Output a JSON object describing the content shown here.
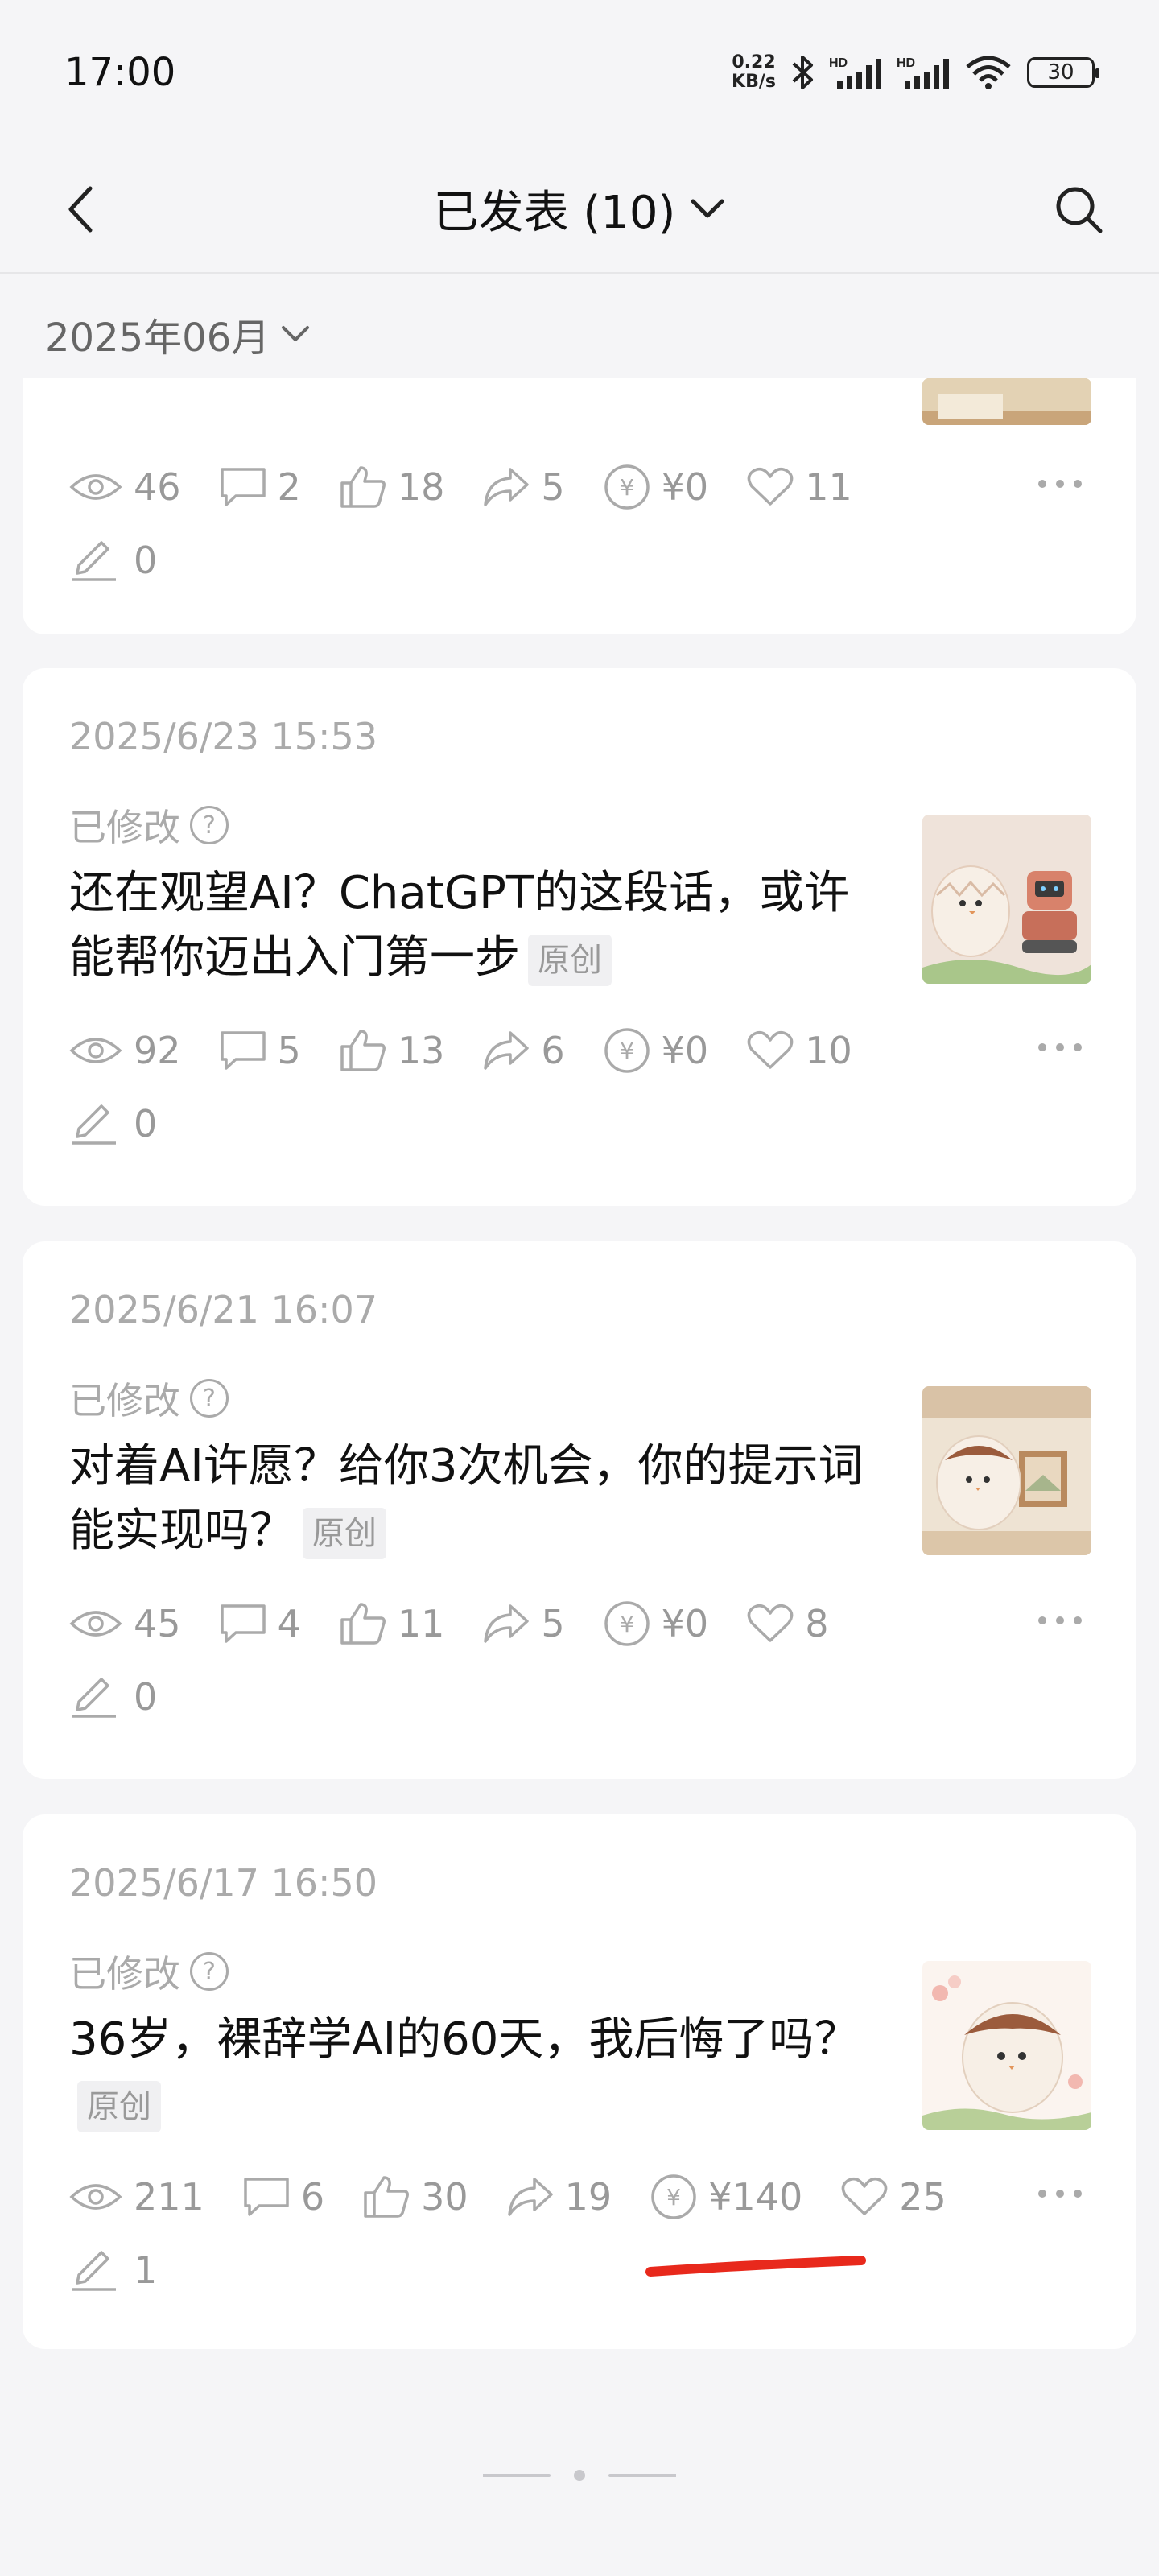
{
  "status_bar": {
    "time": "17:00",
    "net_speed_value": "0.22",
    "net_speed_unit": "KB/s",
    "battery": "30",
    "icons": [
      "bluetooth-icon",
      "hd-signal-icon",
      "hd-signal-icon",
      "wifi-icon",
      "battery-icon"
    ]
  },
  "nav": {
    "title": "已发表 (10)",
    "back_icon": "chevron-left-icon",
    "search_icon": "search-icon"
  },
  "filter": {
    "month": "2025年06月"
  },
  "cards": [
    {
      "stats": {
        "views": "46",
        "comments": "2",
        "likes": "18",
        "shares": "5",
        "earnings": "¥0",
        "favorites": "11",
        "edits": "0"
      }
    },
    {
      "date": "2025/6/23 15:53",
      "edited": "已修改",
      "title": "还在观望AI？ChatGPT的这段话，或许能帮你迈出入门第一步",
      "tag": "原创",
      "stats": {
        "views": "92",
        "comments": "5",
        "likes": "13",
        "shares": "6",
        "earnings": "¥0",
        "favorites": "10",
        "edits": "0"
      }
    },
    {
      "date": "2025/6/21 16:07",
      "edited": "已修改",
      "title": "对着AI许愿？给你3次机会，你的提示词能实现吗？",
      "tag": "原创",
      "stats": {
        "views": "45",
        "comments": "4",
        "likes": "11",
        "shares": "5",
        "earnings": "¥0",
        "favorites": "8",
        "edits": "0"
      }
    },
    {
      "date": "2025/6/17 16:50",
      "edited": "已修改",
      "title": "36岁，裸辞学AI的60天，我后悔了吗？",
      "tag": "原创",
      "stats": {
        "views": "211",
        "comments": "6",
        "likes": "30",
        "shares": "19",
        "earnings": "¥140",
        "favorites": "25",
        "edits": "1"
      }
    }
  ],
  "colors": {
    "accent_underline": "#e8291c",
    "card_bg": "#ffffff",
    "page_bg": "#f5f5f7",
    "muted_text": "#999999"
  }
}
